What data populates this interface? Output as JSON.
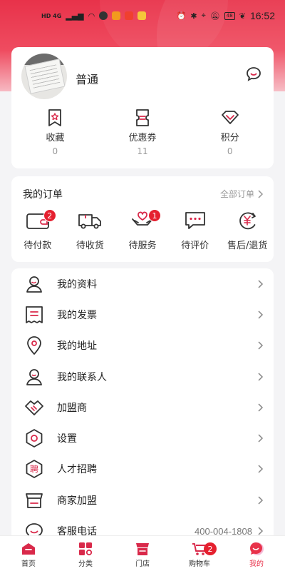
{
  "status_bar": {
    "network": "HD 4G",
    "battery": "48",
    "time": "16:52"
  },
  "profile": {
    "name": "普通",
    "stats": [
      {
        "label": "收藏",
        "value": "0",
        "icon": "star-tag-icon"
      },
      {
        "label": "优惠券",
        "value": "11",
        "icon": "coupon-icon"
      },
      {
        "label": "积分",
        "value": "0",
        "icon": "diamond-icon"
      }
    ]
  },
  "orders": {
    "title": "我的订单",
    "all_label": "全部订单",
    "items": [
      {
        "label": "待付款",
        "badge": "2",
        "icon": "wallet-icon"
      },
      {
        "label": "待收货",
        "badge": "",
        "icon": "truck-icon"
      },
      {
        "label": "待服务",
        "badge": "1",
        "icon": "heart-hands-icon"
      },
      {
        "label": "待评价",
        "badge": "",
        "icon": "comment-icon"
      },
      {
        "label": "售后/退货",
        "badge": "",
        "icon": "refund-icon"
      }
    ]
  },
  "menu": {
    "items": [
      {
        "label": "我的资料",
        "extra": ""
      },
      {
        "label": "我的发票",
        "extra": ""
      },
      {
        "label": "我的地址",
        "extra": ""
      },
      {
        "label": "我的联系人",
        "extra": ""
      },
      {
        "label": "加盟商",
        "extra": ""
      },
      {
        "label": "设置",
        "extra": ""
      },
      {
        "label": "人才招聘",
        "extra": "",
        "icon_text": "聘"
      },
      {
        "label": "商家加盟",
        "extra": ""
      },
      {
        "label": "客服电话",
        "extra": "400-004-1808"
      }
    ]
  },
  "tabbar": {
    "items": [
      {
        "label": "首页",
        "badge": ""
      },
      {
        "label": "分类",
        "badge": ""
      },
      {
        "label": "门店",
        "badge": ""
      },
      {
        "label": "购物车",
        "badge": "2"
      },
      {
        "label": "我的",
        "badge": ""
      }
    ],
    "active_index": 4
  },
  "colors": {
    "accent": "#e8324a",
    "icon_stroke": "#333333",
    "icon_accent": "#d9294a",
    "badge": "#e5202f"
  }
}
